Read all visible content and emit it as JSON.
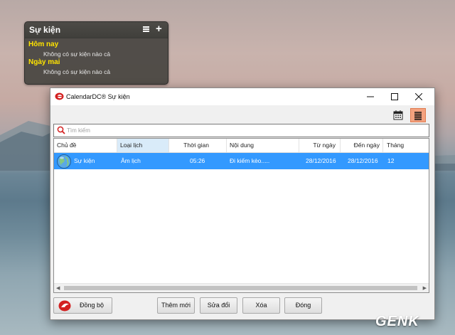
{
  "widget": {
    "title": "Sự kiện",
    "today_label": "Hôm nay",
    "today_note": "Không có sự kiện nào cả",
    "tomorrow_label": "Ngày mai",
    "tomorrow_note": "Không có sự kiện nào cả",
    "add_symbol": "+"
  },
  "window": {
    "title": "CalendarDC® Sự kiện"
  },
  "search": {
    "placeholder": "Tìm kiếm",
    "value": ""
  },
  "table": {
    "columns": [
      "Chủ đề",
      "Loại lịch",
      "Thời gian",
      "Nội dung",
      "Từ ngày",
      "Đến ngày",
      "Tháng"
    ],
    "selected_column": "Loại lịch",
    "rows": [
      {
        "subject": "Sự kiện",
        "calendar_type": "Âm lịch",
        "time": "05:26",
        "content": "Đi kiếm kèo.....",
        "from_date": "28/12/2016",
        "to_date": "28/12/2016",
        "month": "12"
      }
    ]
  },
  "buttons": {
    "sync": "Đồng bộ",
    "add": "Thêm mới",
    "edit": "Sửa đổi",
    "delete": "Xóa",
    "close": "Đóng"
  },
  "watermark": "GENK",
  "colors": {
    "selection": "#3399ff",
    "widget_heading": "#ffe400",
    "active_view_button": "#f4a27f",
    "logo_red": "#d32020"
  }
}
